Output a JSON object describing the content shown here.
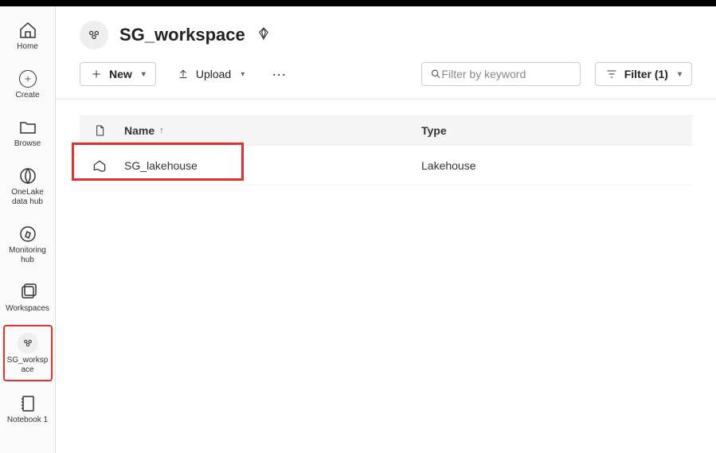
{
  "sidebar": {
    "items": [
      {
        "label": "Home"
      },
      {
        "label": "Create"
      },
      {
        "label": "Browse"
      },
      {
        "label": "OneLake data hub"
      },
      {
        "label": "Monitoring hub"
      },
      {
        "label": "Workspaces"
      },
      {
        "label": "SG_workspace"
      },
      {
        "label": "Notebook 1"
      }
    ]
  },
  "header": {
    "title": "SG_workspace"
  },
  "toolbar": {
    "new_label": "New",
    "upload_label": "Upload",
    "filter_label": "Filter (1)"
  },
  "search": {
    "placeholder": "Filter by keyword"
  },
  "table": {
    "headers": {
      "name": "Name",
      "type": "Type"
    },
    "rows": [
      {
        "name": "SG_lakehouse",
        "type": "Lakehouse"
      }
    ]
  }
}
